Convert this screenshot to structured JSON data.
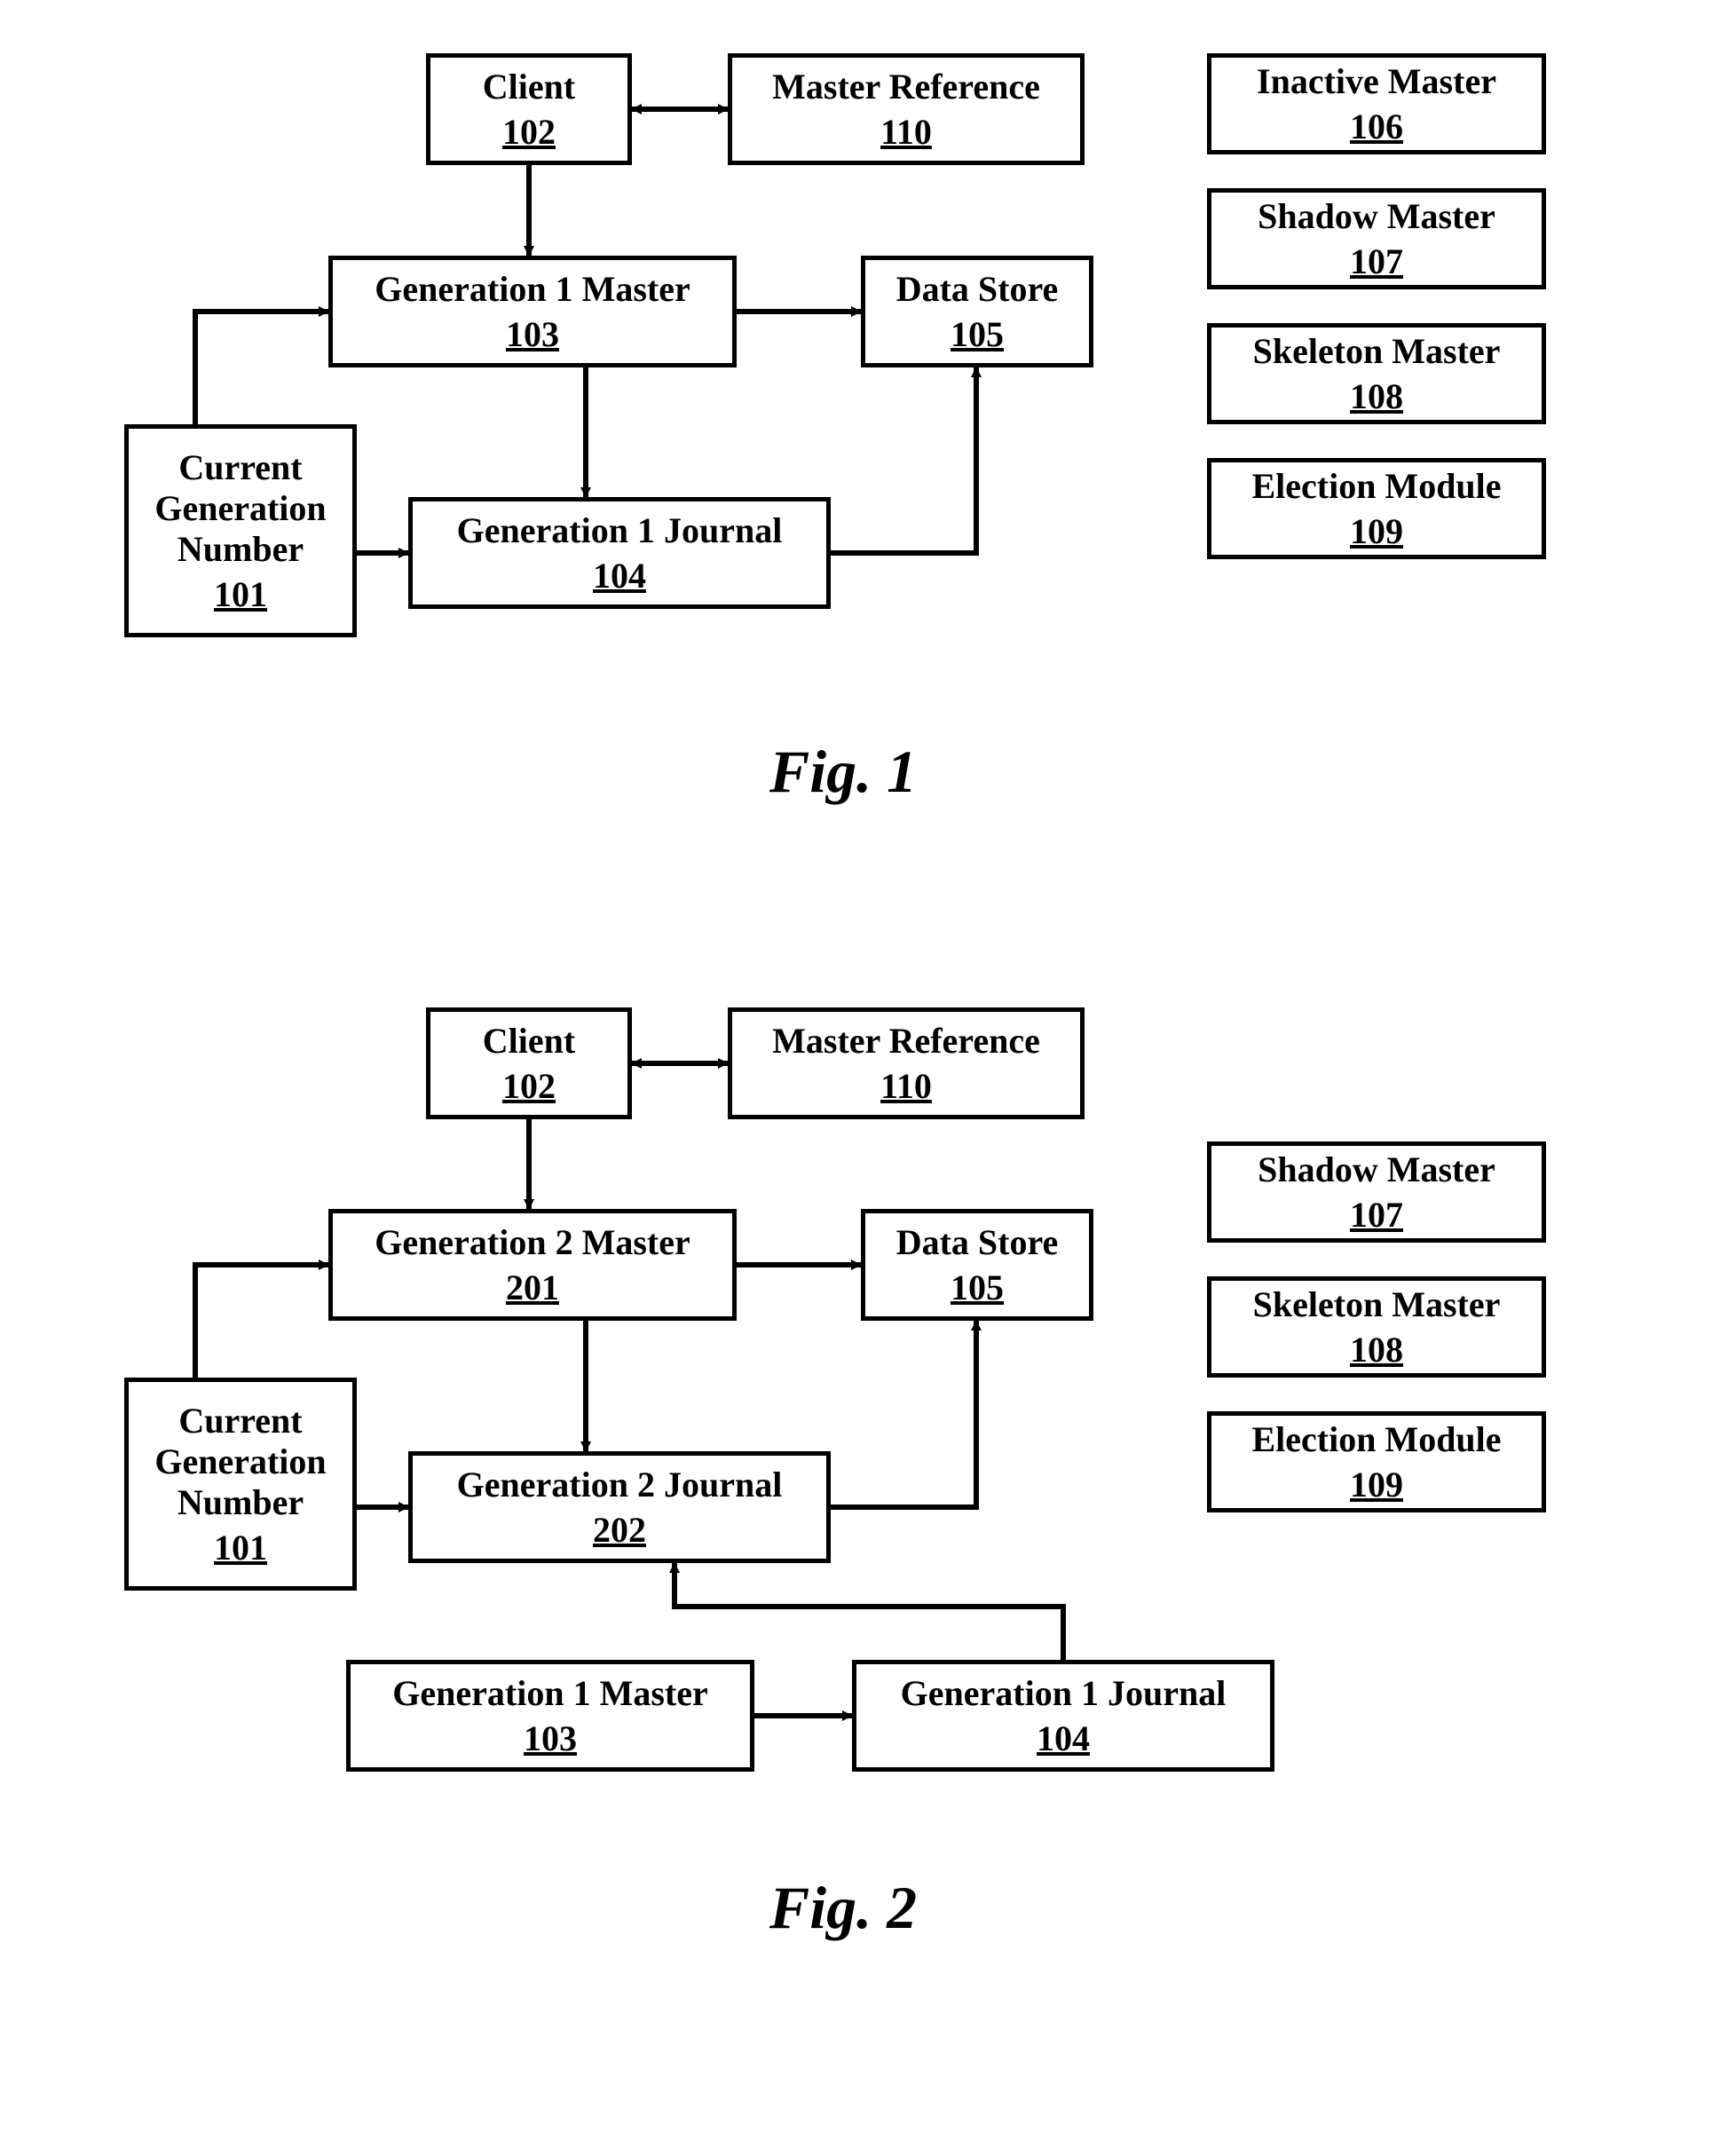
{
  "fig1": {
    "client": {
      "title": "Client",
      "ref": "102"
    },
    "master_ref": {
      "title": "Master Reference",
      "ref": "110"
    },
    "gen1_master": {
      "title": "Generation 1 Master",
      "ref": "103"
    },
    "data_store": {
      "title": "Data Store",
      "ref": "105"
    },
    "gen1_journal": {
      "title": "Generation 1 Journal",
      "ref": "104"
    },
    "cur_gen_num": {
      "title": "Current\nGeneration\nNumber",
      "ref": "101"
    },
    "inactive_master": {
      "title": "Inactive Master",
      "ref": "106"
    },
    "shadow_master": {
      "title": "Shadow Master",
      "ref": "107"
    },
    "skeleton_master": {
      "title": "Skeleton Master",
      "ref": "108"
    },
    "election_module": {
      "title": "Election Module",
      "ref": "109"
    },
    "caption": "Fig. 1"
  },
  "fig2": {
    "client": {
      "title": "Client",
      "ref": "102"
    },
    "master_ref": {
      "title": "Master Reference",
      "ref": "110"
    },
    "gen2_master": {
      "title": "Generation 2 Master",
      "ref": "201"
    },
    "data_store": {
      "title": "Data Store",
      "ref": "105"
    },
    "gen2_journal": {
      "title": "Generation 2 Journal",
      "ref": "202"
    },
    "cur_gen_num": {
      "title": "Current\nGeneration\nNumber",
      "ref": "101"
    },
    "gen1_master": {
      "title": "Generation 1 Master",
      "ref": "103"
    },
    "gen1_journal": {
      "title": "Generation 1 Journal",
      "ref": "104"
    },
    "shadow_master": {
      "title": "Shadow Master",
      "ref": "107"
    },
    "skeleton_master": {
      "title": "Skeleton Master",
      "ref": "108"
    },
    "election_module": {
      "title": "Election Module",
      "ref": "109"
    },
    "caption": "Fig. 2"
  }
}
